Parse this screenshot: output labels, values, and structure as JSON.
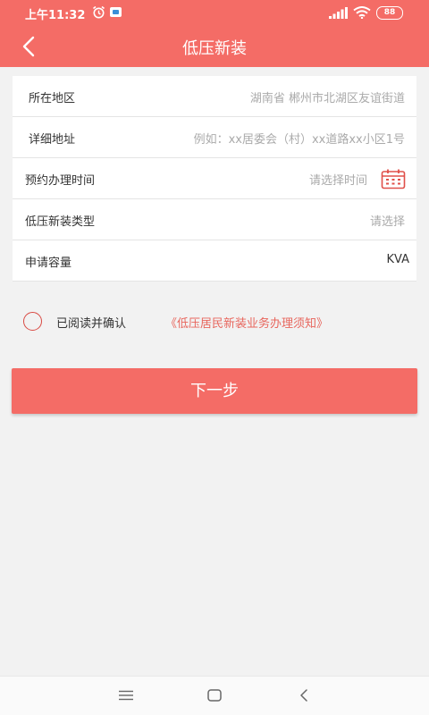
{
  "status_bar": {
    "time": "上午11:32",
    "battery": "88"
  },
  "header": {
    "title": "低压新装",
    "back_icon": "chevron-left-icon"
  },
  "form": {
    "region": {
      "label": "所在地区",
      "value": "湖南省 郴州市北湖区友谊街道"
    },
    "address": {
      "label": "详细地址",
      "placeholder": "例如：xx居委会（村）xx道路xx小区1号"
    },
    "appointment": {
      "label": "预约办理时间",
      "placeholder": "请选择时间",
      "icon": "calendar-icon"
    },
    "install_type": {
      "label": "低压新装类型",
      "placeholder": "请选择"
    },
    "capacity": {
      "label": "申请容量",
      "unit": "KVA"
    }
  },
  "agreement": {
    "text": "已阅读并确认",
    "link": "《低压居民新装业务办理须知》"
  },
  "next_button": "下一步",
  "colors": {
    "primary": "#f46c66",
    "link": "#e8665d",
    "background": "#f2f2f2"
  }
}
